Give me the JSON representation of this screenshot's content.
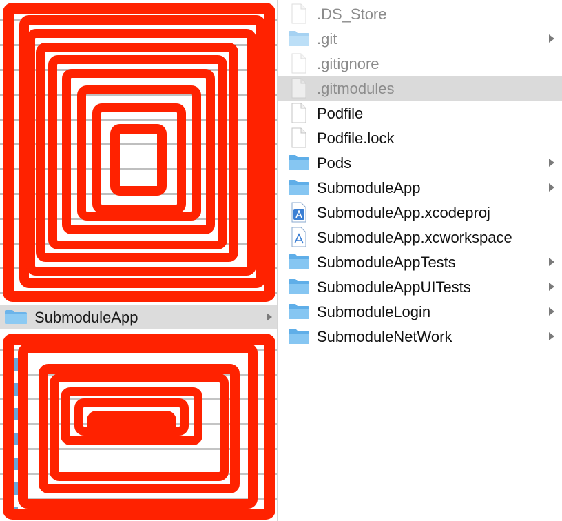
{
  "left_column": {
    "selected_item": {
      "label": "SubmoduleApp",
      "icon": "folder-icon",
      "has_children": true
    }
  },
  "right_column": {
    "items": [
      {
        "name": ".DS_Store",
        "icon": "document-icon",
        "hidden": true,
        "has_children": false,
        "selected": false
      },
      {
        "name": ".git",
        "icon": "folder-icon",
        "hidden": true,
        "has_children": true,
        "selected": false
      },
      {
        "name": ".gitignore",
        "icon": "document-icon",
        "hidden": true,
        "has_children": false,
        "selected": false
      },
      {
        "name": ".gitmodules",
        "icon": "document-icon",
        "hidden": true,
        "has_children": false,
        "selected": true
      },
      {
        "name": "Podfile",
        "icon": "document-icon",
        "hidden": false,
        "has_children": false,
        "selected": false
      },
      {
        "name": "Podfile.lock",
        "icon": "document-icon",
        "hidden": false,
        "has_children": false,
        "selected": false
      },
      {
        "name": "Pods",
        "icon": "folder-icon",
        "hidden": false,
        "has_children": true,
        "selected": false
      },
      {
        "name": "SubmoduleApp",
        "icon": "folder-icon",
        "hidden": false,
        "has_children": true,
        "selected": false
      },
      {
        "name": "SubmoduleApp.xcodeproj",
        "icon": "xcode-project-icon",
        "hidden": false,
        "has_children": false,
        "selected": false
      },
      {
        "name": "SubmoduleApp.xcworkspace",
        "icon": "xcode-workspace-icon",
        "hidden": false,
        "has_children": false,
        "selected": false
      },
      {
        "name": "SubmoduleAppTests",
        "icon": "folder-icon",
        "hidden": false,
        "has_children": true,
        "selected": false
      },
      {
        "name": "SubmoduleAppUITests",
        "icon": "folder-icon",
        "hidden": false,
        "has_children": true,
        "selected": false
      },
      {
        "name": "SubmoduleLogin",
        "icon": "folder-icon",
        "hidden": false,
        "has_children": true,
        "selected": false
      },
      {
        "name": "SubmoduleNetWork",
        "icon": "folder-icon",
        "hidden": false,
        "has_children": true,
        "selected": false
      }
    ]
  },
  "colors": {
    "redaction": "#ff2200",
    "folder": "#6cb4ea",
    "selection": "#dadada"
  }
}
